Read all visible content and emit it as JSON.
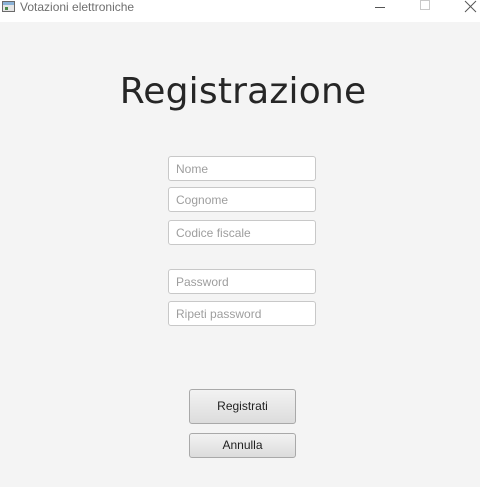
{
  "window": {
    "title": "Votazioni elettroniche",
    "controls": [
      "minimize-icon",
      "maximize-icon",
      "close-icon"
    ]
  },
  "form": {
    "heading": "Registrazione",
    "fields": {
      "nome": {
        "value": "",
        "placeholder": "Nome"
      },
      "cognome": {
        "value": "",
        "placeholder": "Cognome"
      },
      "codice_fiscale": {
        "value": "",
        "placeholder": "Codice fiscale"
      },
      "password": {
        "value": "",
        "placeholder": "Password"
      },
      "ripeti_password": {
        "value": "",
        "placeholder": "Ripeti password"
      }
    },
    "buttons": {
      "register_label": "Registrati",
      "cancel_label": "Annulla"
    }
  },
  "colors": {
    "background": "#f4f4f4",
    "titlebar": "#ffffff",
    "field_border": "#c8c8c8",
    "placeholder": "#9e9e9e",
    "heading": "#262626"
  }
}
